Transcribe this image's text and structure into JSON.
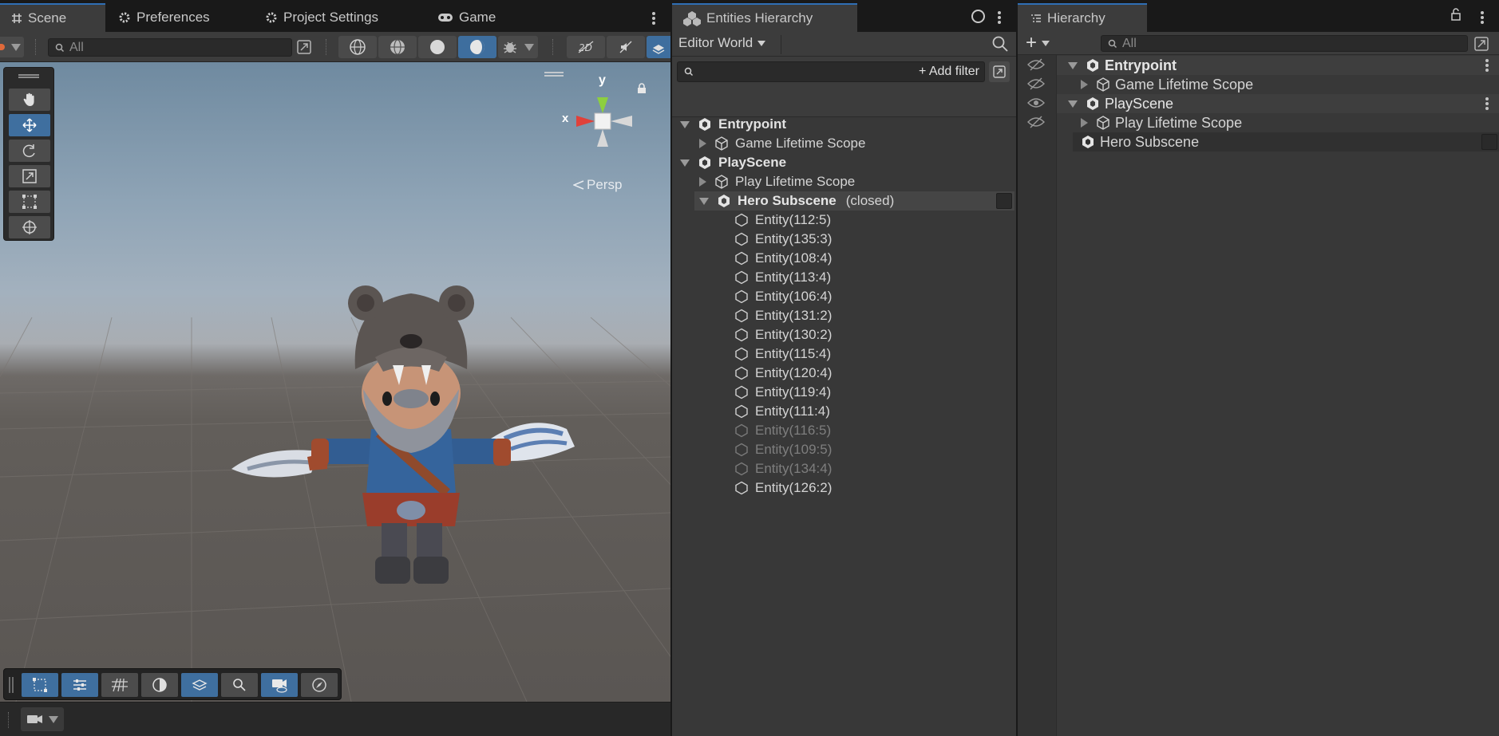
{
  "scene_tabs": {
    "scene": "Scene",
    "preferences": "Preferences",
    "project_settings": "Project Settings",
    "game": "Game"
  },
  "scene_toolbar": {
    "search_placeholder": "All"
  },
  "scene_view": {
    "gizmo_y": "y",
    "gizmo_x": "x",
    "projection_label": "Persp"
  },
  "entities_hierarchy": {
    "tab_label": "Entities Hierarchy",
    "world_selector": "Editor World",
    "add_filter": "+ Add filter",
    "tree": {
      "entrypoint": "Entrypoint",
      "game_lifetime_scope": "Game Lifetime Scope",
      "playscene": "PlayScene",
      "play_lifetime_scope": "Play Lifetime Scope",
      "hero_subscene": "Hero Subscene",
      "hero_subscene_state": "(closed)"
    },
    "entities": [
      {
        "label": "Entity(112:5)",
        "dim": false
      },
      {
        "label": "Entity(135:3)",
        "dim": false
      },
      {
        "label": "Entity(108:4)",
        "dim": false
      },
      {
        "label": "Entity(113:4)",
        "dim": false
      },
      {
        "label": "Entity(106:4)",
        "dim": false
      },
      {
        "label": "Entity(131:2)",
        "dim": false
      },
      {
        "label": "Entity(130:2)",
        "dim": false
      },
      {
        "label": "Entity(115:4)",
        "dim": false
      },
      {
        "label": "Entity(120:4)",
        "dim": false
      },
      {
        "label": "Entity(119:4)",
        "dim": false
      },
      {
        "label": "Entity(111:4)",
        "dim": false
      },
      {
        "label": "Entity(116:5)",
        "dim": true
      },
      {
        "label": "Entity(109:5)",
        "dim": true
      },
      {
        "label": "Entity(134:4)",
        "dim": true
      },
      {
        "label": "Entity(126:2)",
        "dim": false
      }
    ]
  },
  "hierarchy": {
    "tab_label": "Hierarchy",
    "search_placeholder": "All",
    "add_button": "+",
    "tree": {
      "entrypoint": "Entrypoint",
      "game_lifetime_scope": "Game Lifetime Scope",
      "playscene": "PlayScene",
      "play_lifetime_scope": "Play Lifetime Scope",
      "hero_subscene": "Hero Subscene"
    }
  },
  "colors": {
    "accent": "#2f6fb5",
    "selected_tool": "#3f6f9f",
    "panel_bg": "#383838"
  }
}
